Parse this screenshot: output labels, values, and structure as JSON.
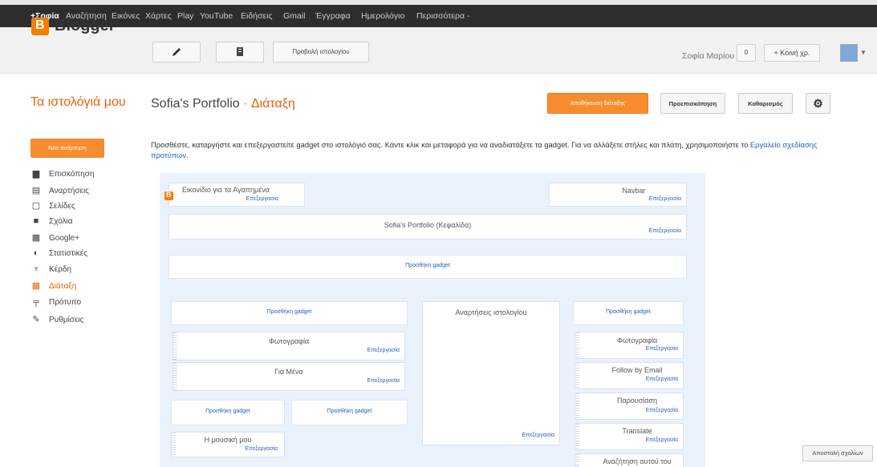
{
  "gbar": {
    "items": [
      "+Σοφία",
      "Αναζήτηση",
      "Εικόνες",
      "Χάρτες",
      "Play",
      "YouTube",
      "Ειδήσεις",
      "Gmail",
      "Έγγραφα",
      "Ημερολόγιο",
      "Περισσότερα -"
    ]
  },
  "header": {
    "logo_letter": "B",
    "logo_text": "Blogger",
    "edit_icon": "pencil-icon",
    "posts_icon": "document-icon",
    "view_blog_label": "Προβολή ιστολογίου",
    "username": "Σοφία Μαρίου",
    "notification_count": "0",
    "share_label": "+ Κοινή χρ.",
    "avatar_icon": "avatar-icon"
  },
  "title": {
    "my_blogs": "Τα ιστολόγιά μου",
    "blog_name": "Sofia's Portfolio",
    "separator": "·",
    "section": "Διάταξη"
  },
  "actions": {
    "save": "Αποθήκευση διάταξης",
    "preview": "Προεπισκόπηση",
    "clear": "Καθαρισμός",
    "settings_icon": "gear-icon"
  },
  "sidebar": {
    "new_post": "Νέα ανάρτηση",
    "items": [
      {
        "label": "Επισκόπηση",
        "icon": "home-icon",
        "glyph": "▆"
      },
      {
        "label": "Αναρτήσεις",
        "icon": "posts-icon",
        "glyph": "▤"
      },
      {
        "label": "Σελίδες",
        "icon": "pages-icon",
        "glyph": "▢"
      },
      {
        "label": "Σχόλια",
        "icon": "comments-icon",
        "glyph": "■"
      },
      {
        "label": "Google+",
        "icon": "googleplus-icon",
        "glyph": "▩"
      },
      {
        "label": "Στατιστικές",
        "icon": "stats-icon",
        "glyph": "◐"
      },
      {
        "label": "Κέρδη",
        "icon": "trophy-icon",
        "glyph": "♆"
      },
      {
        "label": "Διάταξη",
        "icon": "layout-icon",
        "glyph": "▦",
        "active": true
      },
      {
        "label": "Πρότυπο",
        "icon": "template-icon",
        "glyph": "╤"
      },
      {
        "label": "Ρυθμίσεις",
        "icon": "wrench-icon",
        "glyph": "✎"
      }
    ]
  },
  "description": {
    "text": "Προσθέστε, καταργήστε και επεξεργαστείτε gadget στο ιστολόγιό σας. Κάντε κλικ και μεταφορά για να αναδιατάξετε τα gadget. Για να αλλάξετε στήλες και πλάτη, χρησιμοποιήστε το ",
    "link": "Εργαλείο σχεδίασης προτύπων."
  },
  "layout": {
    "edit_label": "Επεξεργασία",
    "add_gadget": "Προσθήκη gadget",
    "favicon": "Εικονίδιο για τα Αγαπημένα",
    "navbar": "Navbar",
    "header": "Sofia's Portfolio (Κεφαλίδα)",
    "blog_posts": "Αναρτήσεις ιστολογίου",
    "left_gadgets": [
      "Φωτογραφία",
      "Για Μένα"
    ],
    "music": "Η μουσική μου",
    "right_gadgets": [
      "Φωτογραφία",
      "Follow by Email",
      "Παρουσίαση",
      "Translate",
      "Αναζήτηση αυτού του"
    ]
  },
  "feedback": "Αποστολή σχολίων"
}
